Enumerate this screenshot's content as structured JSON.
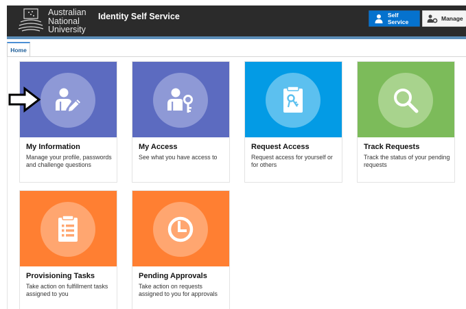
{
  "header": {
    "logo_lines": [
      "Australian",
      "National",
      "University"
    ],
    "app_title": "Identity Self Service",
    "self_service_label": "Self Service",
    "manage_label": "Manage"
  },
  "tabs": [
    {
      "label": "Home",
      "active": true
    }
  ],
  "colors": {
    "header_bg": "#2b2b2b",
    "accent_blue": "#0572ce",
    "tile_indigo": "#5c6bc0",
    "tile_blue": "#039be5",
    "tile_green": "#7cbb5a",
    "tile_orange": "#ff7f32"
  },
  "tiles": [
    {
      "title": "My Information",
      "description": "Manage your profile, passwords and challenge questions",
      "icon": "user-edit-icon",
      "color": "#5c6bc0"
    },
    {
      "title": "My Access",
      "description": "See what you have access to",
      "icon": "user-key-icon",
      "color": "#5c6bc0"
    },
    {
      "title": "Request Access",
      "description": "Request access for yourself or for others",
      "icon": "clipboard-key-icon",
      "color": "#039be5"
    },
    {
      "title": "Track Requests",
      "description": "Track the status of your pending requests",
      "icon": "magnifier-icon",
      "color": "#7cbb5a"
    },
    {
      "title": "Provisioning Tasks",
      "description": "Take action on fulfillment tasks assigned to you",
      "icon": "task-list-icon",
      "color": "#ff7f32"
    },
    {
      "title": "Pending Approvals",
      "description": "Take action on requests assigned to you for approvals",
      "icon": "clock-icon",
      "color": "#ff7f32"
    }
  ]
}
